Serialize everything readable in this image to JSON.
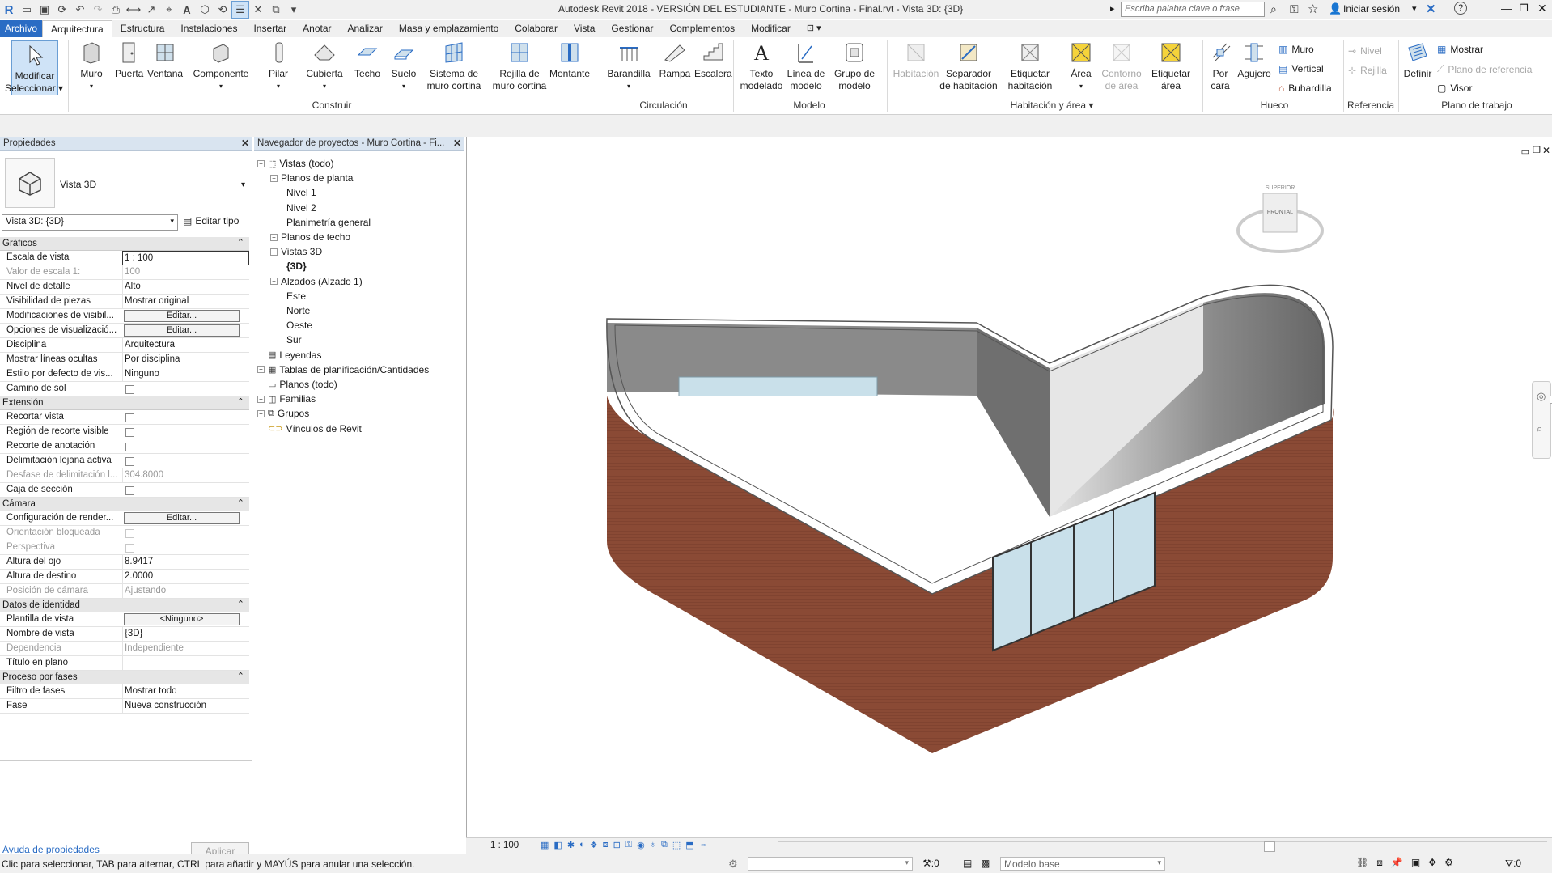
{
  "titlebar": {
    "title": "Autodesk Revit 2018 - VERSIÓN DEL ESTUDIANTE -    Muro Cortina - Final.rvt - Vista 3D: {3D}",
    "search_placeholder": "Escriba palabra clave o frase",
    "signin": "Iniciar sesión",
    "help": "?"
  },
  "tabs": [
    "Archivo",
    "Arquitectura",
    "Estructura",
    "Instalaciones",
    "Insertar",
    "Anotar",
    "Analizar",
    "Masa y emplazamiento",
    "Colaborar",
    "Vista",
    "Gestionar",
    "Complementos",
    "Modificar"
  ],
  "ribbon": {
    "modify": "Modificar",
    "select": "Seleccionar",
    "build": {
      "label": "Construir",
      "items": [
        "Muro",
        "Puerta",
        "Ventana",
        "Componente",
        "Pilar",
        "Cubierta",
        "Techo",
        "Suelo",
        "Sistema de\nmuro cortina",
        "Rejilla de\nmuro cortina",
        "Montante"
      ]
    },
    "circulation": {
      "label": "Circulación",
      "items": [
        "Barandilla",
        "Rampa",
        "Escalera"
      ]
    },
    "model": {
      "label": "Modelo",
      "items": [
        "Texto\nmodelado",
        "Línea de\nmodelo",
        "Grupo de\nmodelo"
      ]
    },
    "room": {
      "label": "Habitación y área",
      "items": [
        "Habitación",
        "Separador\nde habitación",
        "Etiquetar\nhabitación",
        "Área",
        "Contorno\nde área",
        "Etiquetar\nárea"
      ]
    },
    "opening": {
      "label": "Hueco",
      "items": [
        "Por\ncara",
        "Agujero"
      ],
      "small": [
        "Muro",
        "Vertical",
        "Buhardilla"
      ]
    },
    "datum": {
      "label": "Referencia",
      "small": [
        "Nivel",
        "Rejilla"
      ]
    },
    "workplane": {
      "label": "Plano de trabajo",
      "big": "Definir",
      "small": [
        "Mostrar",
        "Plano de referencia",
        "Visor"
      ]
    }
  },
  "properties": {
    "title": "Propiedades",
    "type_name": "Vista 3D",
    "selector": "Vista 3D: {3D}",
    "edit_type": "Editar tipo",
    "groups": {
      "graficos": "Gráficos",
      "extension": "Extensión",
      "camara": "Cámara",
      "identidad": "Datos de identidad",
      "fases": "Proceso por fases"
    },
    "rows": {
      "escala": [
        "Escala de vista",
        "1 : 100"
      ],
      "valor": [
        "Valor de escala    1:",
        "100"
      ],
      "detalle": [
        "Nivel de detalle",
        "Alto"
      ],
      "piezas": [
        "Visibilidad de piezas",
        "Mostrar original"
      ],
      "modvis": [
        "Modificaciones de visibil...",
        "Editar..."
      ],
      "opvis": [
        "Opciones de visualizació...",
        "Editar..."
      ],
      "disciplina": [
        "Disciplina",
        "Arquitectura"
      ],
      "ocultas": [
        "Mostrar líneas ocultas",
        "Por disciplina"
      ],
      "estilo": [
        "Estilo por defecto de vis...",
        "Ninguno"
      ],
      "sol": [
        "Camino de sol",
        ""
      ],
      "recortar": [
        "Recortar vista",
        ""
      ],
      "region": [
        "Región de recorte visible",
        ""
      ],
      "anot": [
        "Recorte de anotación",
        ""
      ],
      "lejana": [
        "Delimitación lejana activa",
        ""
      ],
      "desfase": [
        "Desfase de delimitación l...",
        "304.8000"
      ],
      "caja": [
        "Caja de sección",
        ""
      ],
      "render": [
        "Configuración de render...",
        "Editar..."
      ],
      "orient": [
        "Orientación bloqueada",
        ""
      ],
      "persp": [
        "Perspectiva",
        ""
      ],
      "ojo": [
        "Altura del ojo",
        "8.9417"
      ],
      "destino": [
        "Altura de destino",
        "2.0000"
      ],
      "posicion": [
        "Posición de cámara",
        "Ajustando"
      ],
      "plantilla": [
        "Plantilla de vista",
        "<Ninguno>"
      ],
      "nombre": [
        "Nombre de vista",
        "{3D}"
      ],
      "dependencia": [
        "Dependencia",
        "Independiente"
      ],
      "titulo": [
        "Título en plano",
        ""
      ],
      "filtro": [
        "Filtro de fases",
        "Mostrar todo"
      ],
      "fase": [
        "Fase",
        "Nueva construcción"
      ]
    },
    "help_link": "Ayuda de propiedades",
    "apply": "Aplicar"
  },
  "browser": {
    "title": "Navegador de proyectos - Muro Cortina - Fi...",
    "nodes": [
      "Vistas (todo)",
      "Planos de planta",
      "Nivel 1",
      "Nivel 2",
      "Planimetría general",
      "Planos de techo",
      "Vistas 3D",
      "{3D}",
      "Alzados (Alzado 1)",
      "Este",
      "Norte",
      "Oeste",
      "Sur",
      "Leyendas",
      "Tablas de planificación/Cantidades",
      "Planos (todo)",
      "Familias",
      "Grupos",
      "Vínculos de Revit"
    ]
  },
  "viewcube": {
    "top": "SUPERIOR",
    "front": "FRONTAL"
  },
  "viewbar": {
    "scale": "1 : 100"
  },
  "status": {
    "message": "Clic para seleccionar, TAB para alternar, CTRL para añadir y MAYÚS para anular una selección.",
    "zero": ":0",
    "model": "Modelo base",
    "filter": ":0"
  },
  "colors": {
    "brick": "#8a4a35",
    "glass": "#c9e0ea",
    "accent": "#2a6cc4"
  }
}
